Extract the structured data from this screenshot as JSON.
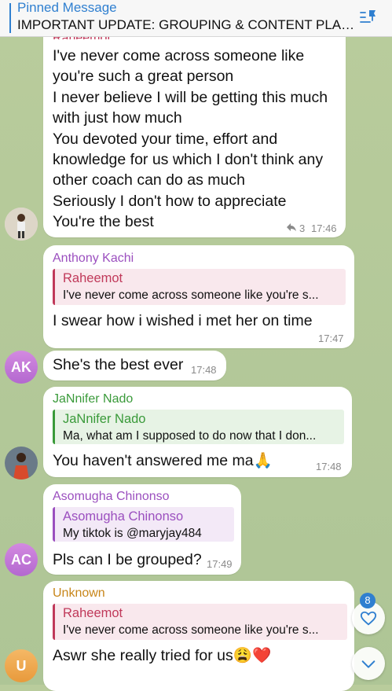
{
  "pinned": {
    "label": "Pinned Message",
    "text": "IMPORTANT UPDATE: GROUPING & CONTENT PLAN..."
  },
  "msg1": {
    "cut_sender": "Raheemot",
    "lines": [
      "I've never come across someone like",
      "you're such a great person",
      "I never believe I will be getting this much",
      "with just how much",
      "You devoted your time, effort and",
      "knowledge for us which I don't think any",
      "other coach can do as much",
      "Seriously I don't how to appreciate",
      "You're the best"
    ],
    "reply_count": "3",
    "time": "17:46"
  },
  "msg2": {
    "sender": "Anthony Kachi",
    "reply_name": "Raheemot",
    "reply_text": "I've never come across someone like you're s...",
    "text": "I swear how i wished i met her on time",
    "time": "17:47"
  },
  "msg3": {
    "avatar_initials": "AK",
    "text": "She's the best ever",
    "time": "17:48"
  },
  "msg4": {
    "sender": "JaNnifer Nado",
    "reply_name": "JaNnifer Nado",
    "reply_text": "Ma, what am I supposed to do now that I don...",
    "text": "You haven't answered me ma🙏",
    "time": "17:48"
  },
  "msg5": {
    "sender": "Asomugha Chinonso",
    "reply_name": "Asomugha Chinonso",
    "reply_text": "My tiktok is @maryjay484",
    "text": "Pls can I be grouped?",
    "time": "17:49",
    "avatar_initials": "AC"
  },
  "msg6": {
    "sender": "Unknown",
    "reply_name": "Raheemot",
    "reply_text": "I've never come across someone like you're s...",
    "text": "Aswr she really tried for us😩❤️",
    "avatar_initials": "U"
  },
  "mentions_badge": "8",
  "colors": {
    "accent": "#2f7fd0",
    "anthony": "#9b4fbf",
    "jannifer": "#3a9a3a",
    "asomugha": "#9b4fbf",
    "unknown": "#c8861a",
    "raheemot_reply": "#c0395a"
  }
}
